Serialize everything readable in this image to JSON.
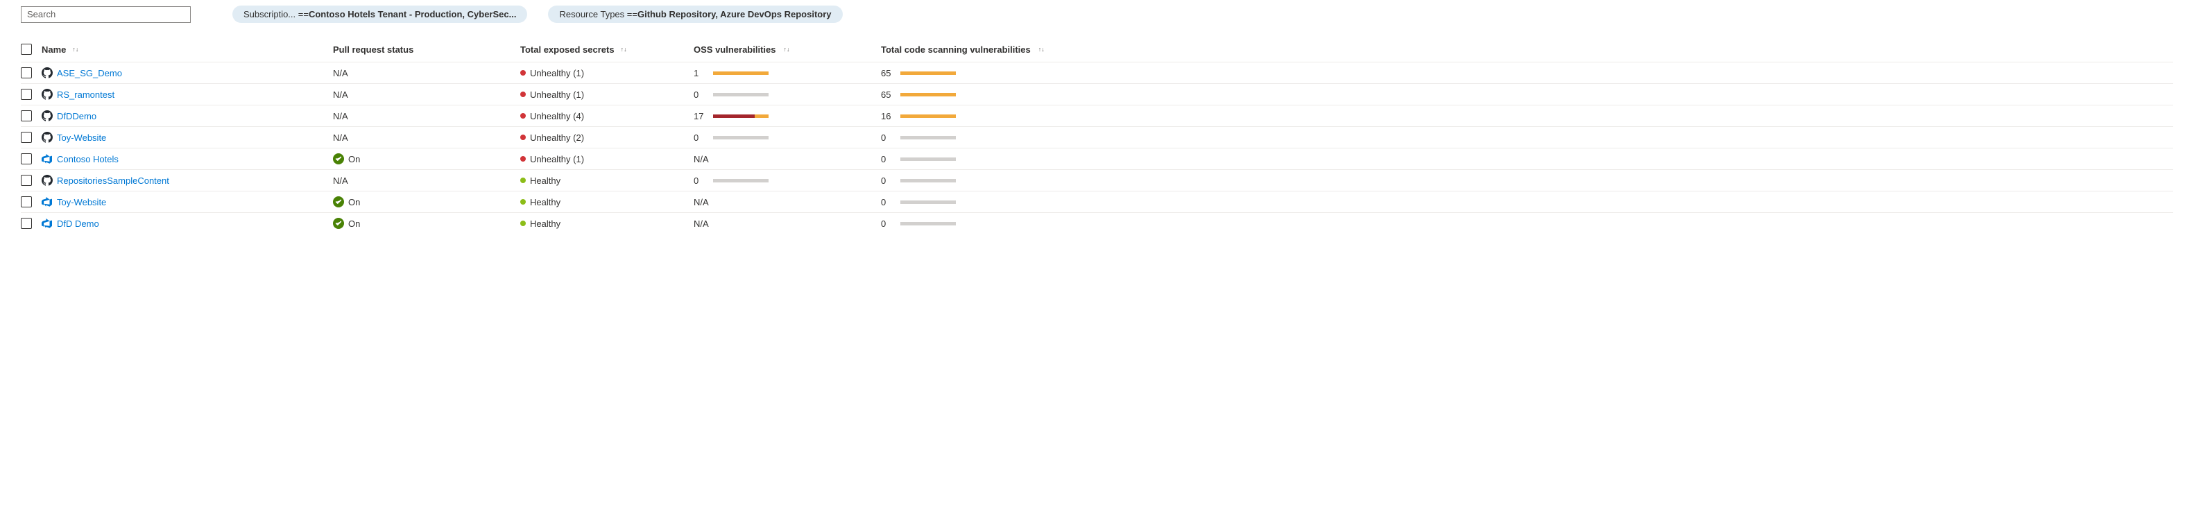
{
  "search": {
    "placeholder": "Search"
  },
  "filters": [
    {
      "prefix": "Subscriptio... == ",
      "value": "Contoso Hotels Tenant - Production, CyberSec..."
    },
    {
      "prefix": "Resource Types == ",
      "value": "Github Repository, Azure DevOps Repository"
    }
  ],
  "columns": {
    "name": "Name",
    "pull_request_status": "Pull request status",
    "total_exposed_secrets": "Total exposed secrets",
    "oss_vulnerabilities": "OSS vulnerabilities",
    "total_code_scanning_vulnerabilities": "Total code scanning vulnerabilities"
  },
  "rows": [
    {
      "icon": "github",
      "name": "ASE_SG_Demo",
      "pr_status": {
        "type": "text",
        "label": "N/A"
      },
      "secrets": {
        "status": "unhealthy",
        "label": "Unhealthy (1)"
      },
      "oss": {
        "value": "1",
        "bar": {
          "width": 80,
          "segments": [
            {
              "color": "#f2a93b",
              "width": 80
            }
          ]
        }
      },
      "code": {
        "value": "65",
        "bar": {
          "width": 80,
          "segments": [
            {
              "color": "#f2a93b",
              "width": 80
            }
          ]
        }
      }
    },
    {
      "icon": "github",
      "name": "RS_ramontest",
      "pr_status": {
        "type": "text",
        "label": "N/A"
      },
      "secrets": {
        "status": "unhealthy",
        "label": "Unhealthy (1)"
      },
      "oss": {
        "value": "0",
        "bar": {
          "width": 80,
          "segments": [
            {
              "color": "#d2d0ce",
              "width": 80
            }
          ]
        }
      },
      "code": {
        "value": "65",
        "bar": {
          "width": 80,
          "segments": [
            {
              "color": "#f2a93b",
              "width": 80
            }
          ]
        }
      }
    },
    {
      "icon": "github",
      "name": "DfDDemo",
      "pr_status": {
        "type": "text",
        "label": "N/A"
      },
      "secrets": {
        "status": "unhealthy",
        "label": "Unhealthy (4)"
      },
      "oss": {
        "value": "17",
        "bar": {
          "width": 80,
          "segments": [
            {
              "color": "#a4262c",
              "width": 60
            },
            {
              "color": "#f2a93b",
              "width": 20
            }
          ]
        }
      },
      "code": {
        "value": "16",
        "bar": {
          "width": 80,
          "segments": [
            {
              "color": "#f2a93b",
              "width": 80
            }
          ]
        }
      }
    },
    {
      "icon": "github",
      "name": "Toy-Website",
      "pr_status": {
        "type": "text",
        "label": "N/A"
      },
      "secrets": {
        "status": "unhealthy",
        "label": "Unhealthy (2)"
      },
      "oss": {
        "value": "0",
        "bar": {
          "width": 80,
          "segments": [
            {
              "color": "#d2d0ce",
              "width": 80
            }
          ]
        }
      },
      "code": {
        "value": "0",
        "bar": {
          "width": 80,
          "segments": [
            {
              "color": "#d2d0ce",
              "width": 80
            }
          ]
        }
      }
    },
    {
      "icon": "devops",
      "name": "Contoso Hotels",
      "pr_status": {
        "type": "check",
        "label": "On"
      },
      "secrets": {
        "status": "unhealthy",
        "label": "Unhealthy (1)"
      },
      "oss": {
        "value": "N/A",
        "bar": null
      },
      "code": {
        "value": "0",
        "bar": {
          "width": 80,
          "segments": [
            {
              "color": "#d2d0ce",
              "width": 80
            }
          ]
        }
      }
    },
    {
      "icon": "github",
      "name": "RepositoriesSampleContent",
      "pr_status": {
        "type": "text",
        "label": "N/A"
      },
      "secrets": {
        "status": "healthy",
        "label": "Healthy"
      },
      "oss": {
        "value": "0",
        "bar": {
          "width": 80,
          "segments": [
            {
              "color": "#d2d0ce",
              "width": 80
            }
          ]
        }
      },
      "code": {
        "value": "0",
        "bar": {
          "width": 80,
          "segments": [
            {
              "color": "#d2d0ce",
              "width": 80
            }
          ]
        }
      }
    },
    {
      "icon": "devops",
      "name": "Toy-Website",
      "pr_status": {
        "type": "check",
        "label": "On"
      },
      "secrets": {
        "status": "healthy",
        "label": "Healthy"
      },
      "oss": {
        "value": "N/A",
        "bar": null
      },
      "code": {
        "value": "0",
        "bar": {
          "width": 80,
          "segments": [
            {
              "color": "#d2d0ce",
              "width": 80
            }
          ]
        }
      }
    },
    {
      "icon": "devops",
      "name": "DfD Demo",
      "pr_status": {
        "type": "check",
        "label": "On"
      },
      "secrets": {
        "status": "healthy",
        "label": "Healthy"
      },
      "oss": {
        "value": "N/A",
        "bar": null
      },
      "code": {
        "value": "0",
        "bar": {
          "width": 80,
          "segments": [
            {
              "color": "#d2d0ce",
              "width": 80
            }
          ]
        }
      }
    }
  ]
}
